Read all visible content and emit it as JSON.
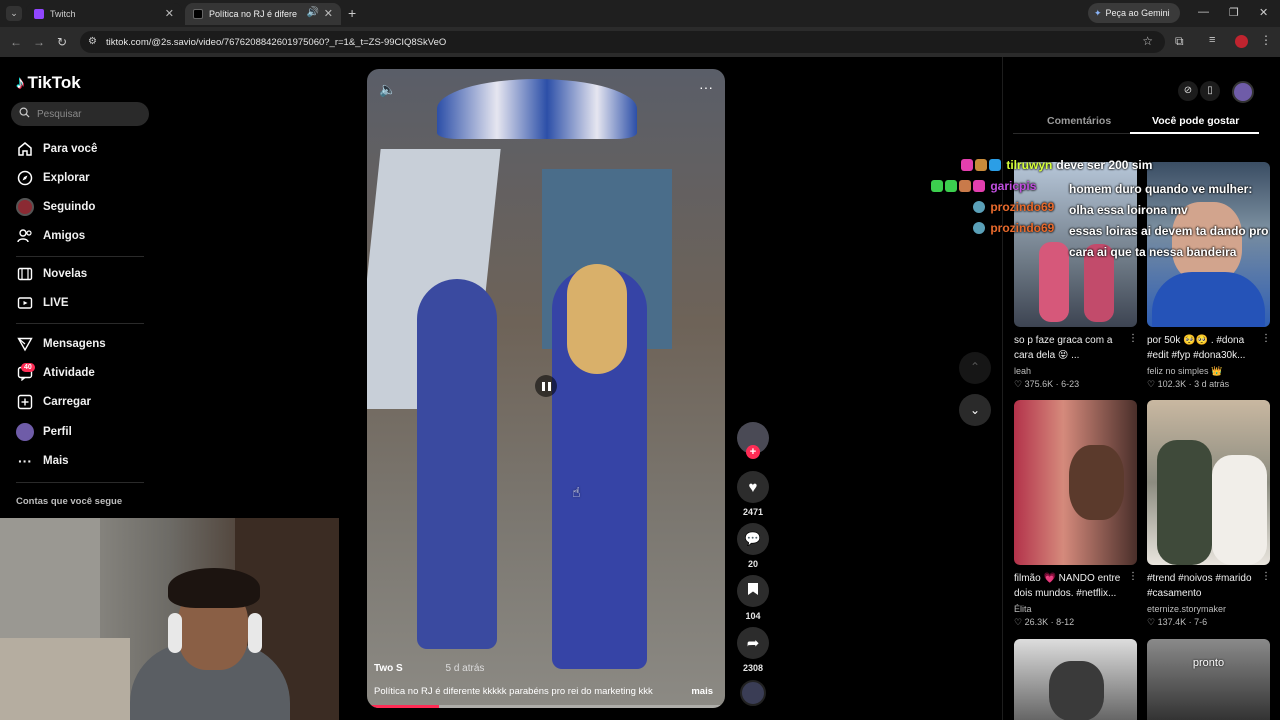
{
  "browser": {
    "tabs": [
      {
        "title": "Twitch",
        "favicon_color": "#9146ff"
      },
      {
        "title": "Política no RJ é diferente: p...",
        "favicon_color": "#000000"
      }
    ],
    "url": "tiktok.com/@2s.savio/video/7676208842601975060?_r=1&_t=ZS-99CIQ8SkVeO",
    "gemini_label": "Peça ao Gemini"
  },
  "sidebar": {
    "logo": "TikTok",
    "search_placeholder": "Pesquisar",
    "items": [
      {
        "label": "Para você"
      },
      {
        "label": "Explorar"
      },
      {
        "label": "Seguindo"
      },
      {
        "label": "Amigos"
      },
      {
        "label": "Novelas"
      },
      {
        "label": "LIVE"
      },
      {
        "label": "Mensagens"
      },
      {
        "label": "Atividade",
        "badge": "40"
      },
      {
        "label": "Carregar"
      },
      {
        "label": "Perfil"
      },
      {
        "label": "Mais"
      }
    ],
    "following_header": "Contas que você segue"
  },
  "video": {
    "author": "Two S",
    "time_ago": "5 d atrás",
    "caption": "Política no RJ é diferente kkkkk parabéns pro rei do marketing kkk",
    "more": "mais",
    "progress": 0.2
  },
  "actions": {
    "likes": "2471",
    "comments": "20",
    "saves": "104",
    "shares": "2308"
  },
  "right_panel": {
    "tabs": [
      "Comentários",
      "Você pode gostar"
    ],
    "active_tab": 1,
    "cards": [
      {
        "title": "so p faze graca com a cara dela 😝 ...",
        "author": "leah",
        "views": "375.6K",
        "date": "6-23"
      },
      {
        "title": "por 50k 🥺🥺 . #dona #edit #fyp #dona30k...",
        "author": "feliz no simples 👑",
        "views": "102.3K",
        "date": "3 d atrás"
      },
      {
        "title": "filmão 💗 NANDO entre dois mundos. #netflix...",
        "author": "Élita",
        "views": "26.3K",
        "date": "8-12"
      },
      {
        "title": "#trend #noivos #marido #casamento",
        "author": "eternize.storymaker",
        "views": "137.4K",
        "date": "7-6"
      },
      {
        "title": "",
        "author": "",
        "views": "",
        "date": ""
      },
      {
        "title": "pronto",
        "author": "",
        "views": "",
        "date": ""
      }
    ]
  },
  "chat": [
    {
      "user": "tilruwyn",
      "user_color": "#d6ff3a",
      "message": "deve ser 200 sim"
    },
    {
      "user": "garicpis",
      "user_color": "#c14fe0",
      "message": "homem duro quando ve mulher: olha essa loirona mv"
    },
    {
      "user": "prozindo69",
      "user_color": "#e96a2c",
      "message": ""
    },
    {
      "user": "prozindo69",
      "user_color": "#e96a2c",
      "message": "essas loiras ai devem ta dando pro cara ai que ta nessa bandeira"
    }
  ]
}
